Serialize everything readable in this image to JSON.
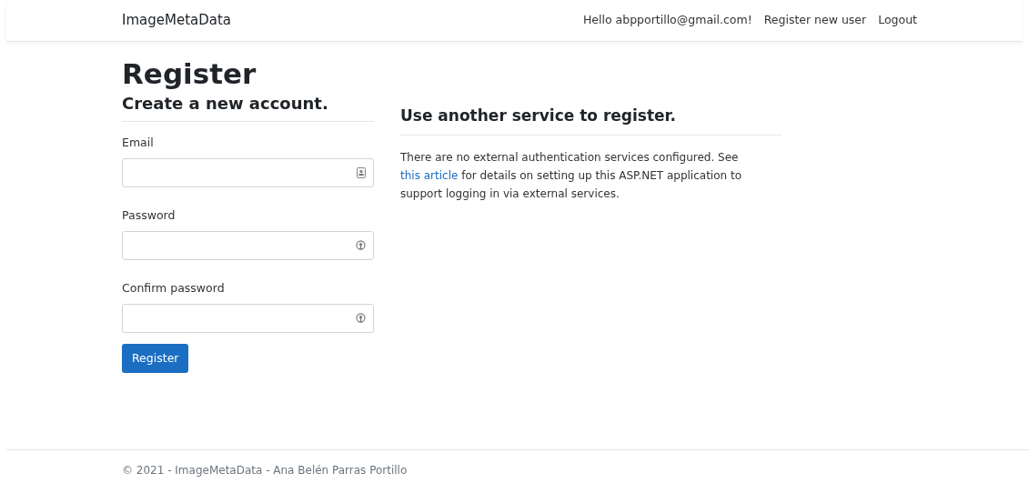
{
  "navbar": {
    "brand": "ImageMetaData",
    "links": [
      "Hello abpportillo@gmail.com!",
      "Register new user",
      "Logout"
    ]
  },
  "page_title": "Register",
  "form": {
    "heading": "Create a new account.",
    "fields": [
      {
        "label": "Email",
        "kind": "email"
      },
      {
        "label": "Password",
        "kind": "password"
      },
      {
        "label": "Confirm password",
        "kind": "password"
      }
    ],
    "submit": "Register"
  },
  "external": {
    "heading": "Use another service to register.",
    "text_before": "There are no external authentication services configured. See",
    "link": "this article",
    "text_after": "for details on setting up this ASP.NET application to support logging in via external services."
  },
  "footer": "© 2021 - ImageMetaData - Ana Belén Parras Portillo"
}
